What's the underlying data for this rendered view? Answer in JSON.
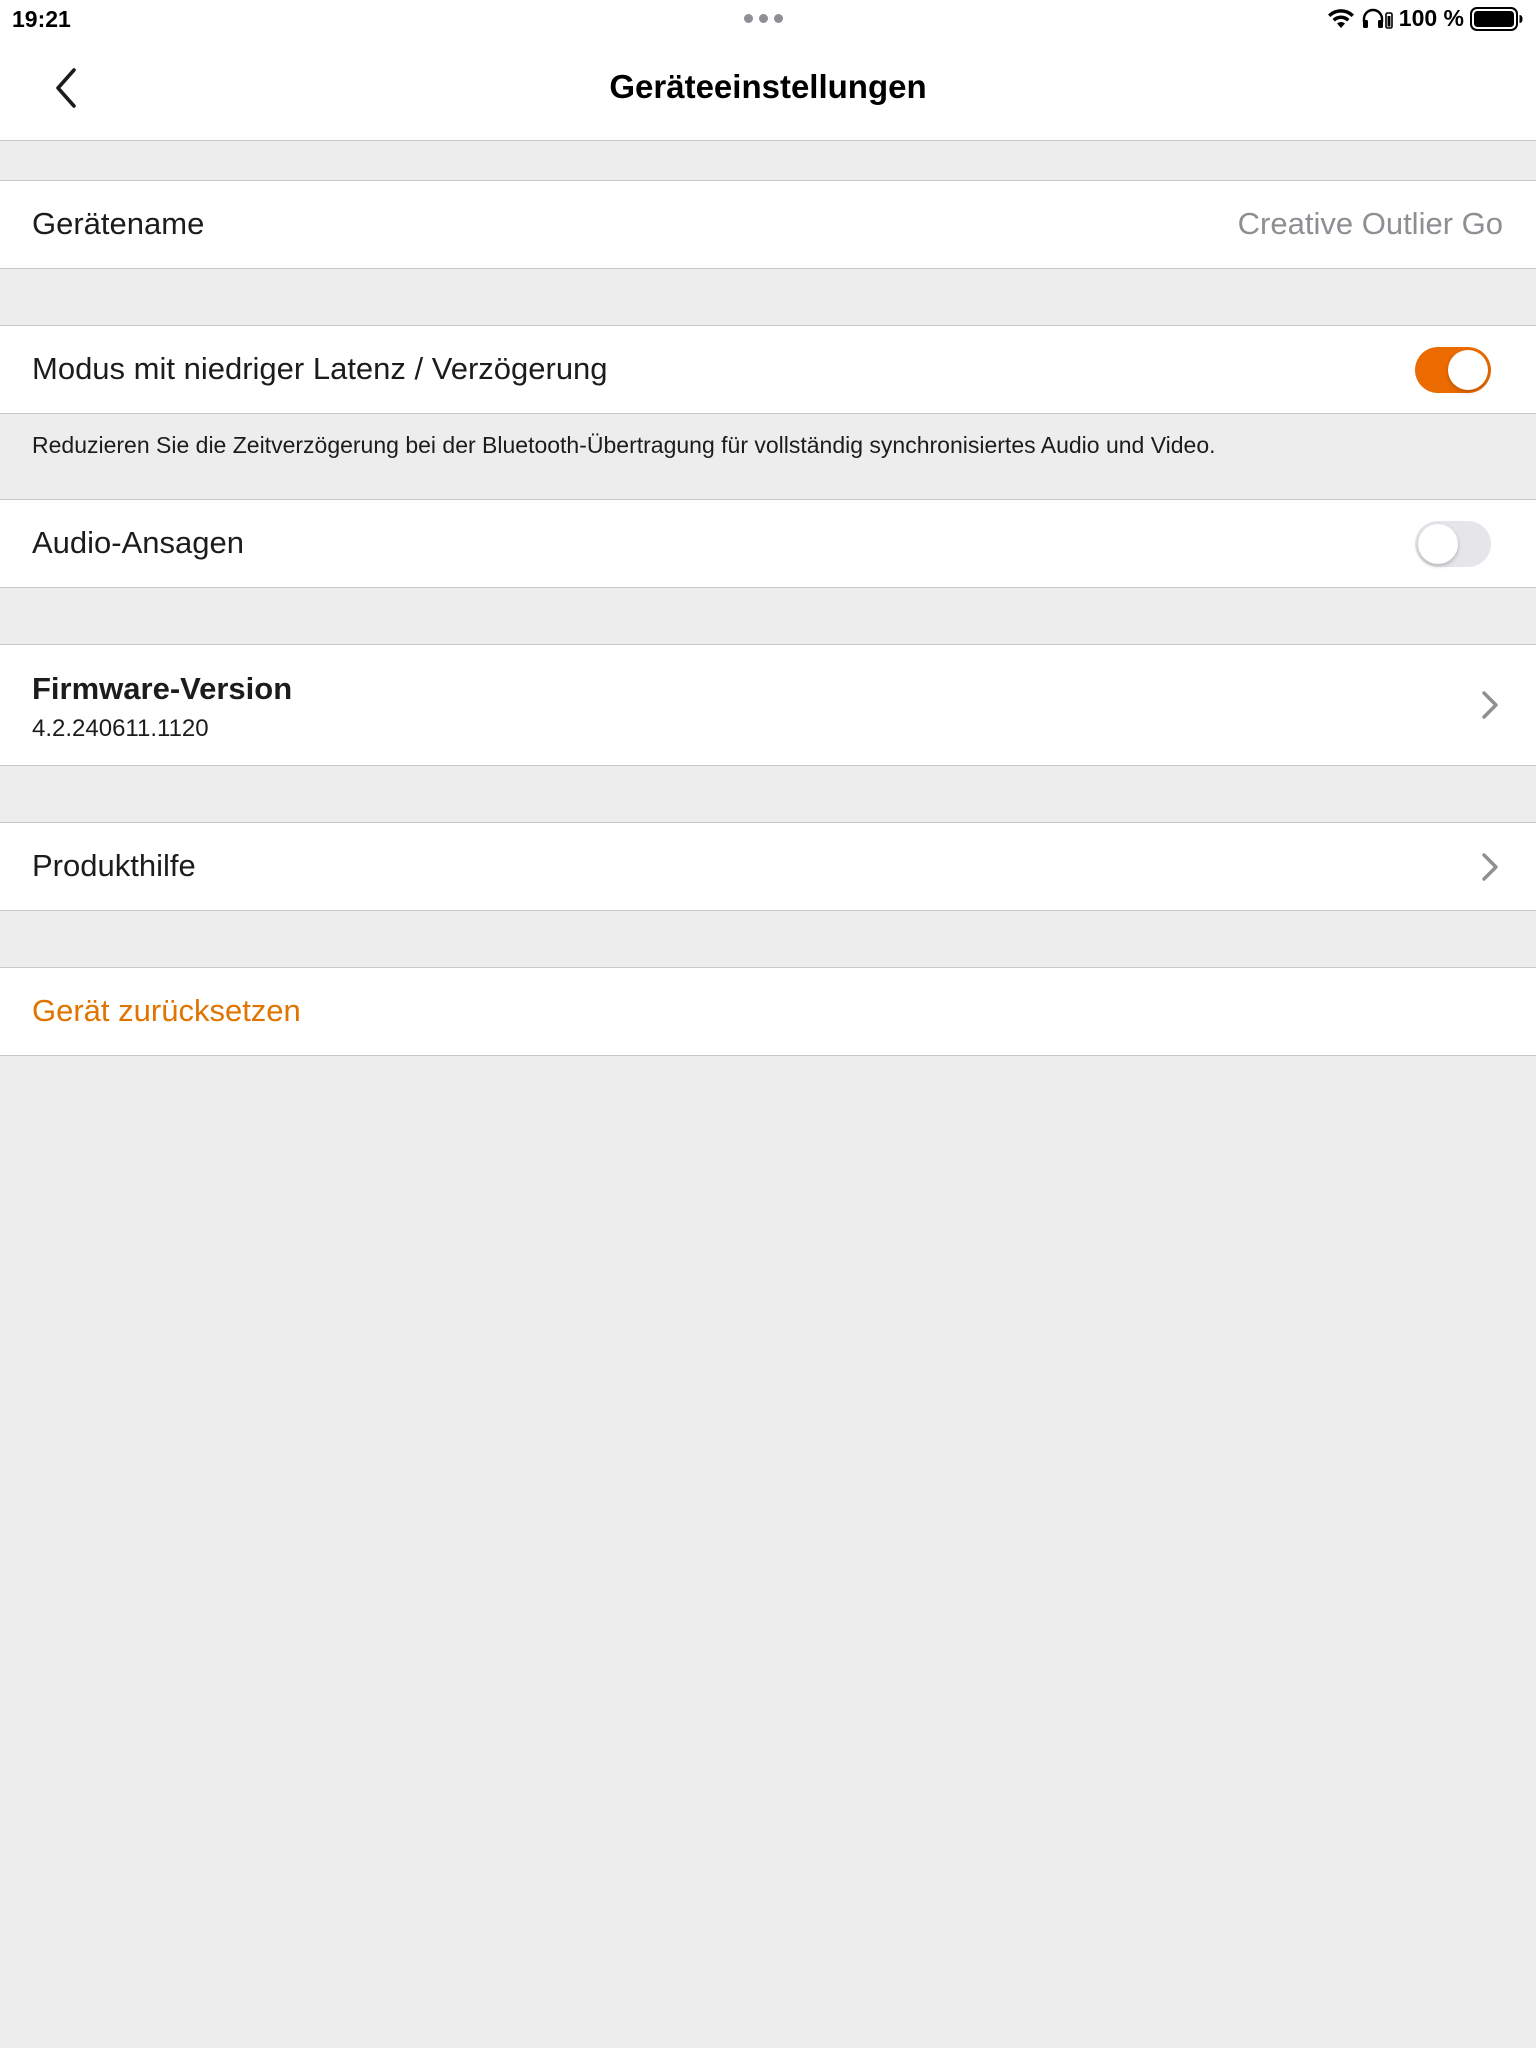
{
  "status_bar": {
    "time": "19:21",
    "battery_text": "100 %",
    "icons": [
      "wifi-icon",
      "headphones-icon",
      "battery-icon"
    ]
  },
  "nav": {
    "title": "Geräteeinstellungen",
    "back_icon": "chevron-left-icon"
  },
  "device_name": {
    "label": "Gerätename",
    "value": "Creative Outlier Go"
  },
  "low_latency": {
    "label": "Modus mit niedriger Latenz / Verzögerung",
    "enabled": true,
    "description": "Reduzieren Sie die Zeitverzögerung bei der Bluetooth-Übertragung für vollständig synchronisiertes Audio und Video."
  },
  "audio_announcements": {
    "label": "Audio-Ansagen",
    "enabled": false
  },
  "firmware": {
    "label": "Firmware-Version",
    "version": "4.2.240611.1120"
  },
  "product_help": {
    "label": "Produkthilfe"
  },
  "reset": {
    "label": "Gerät zurücksetzen"
  },
  "colors": {
    "accent": "#ec6b00",
    "background": "#ededed",
    "row": "#ffffff",
    "secondary_text": "#8e8e93"
  }
}
